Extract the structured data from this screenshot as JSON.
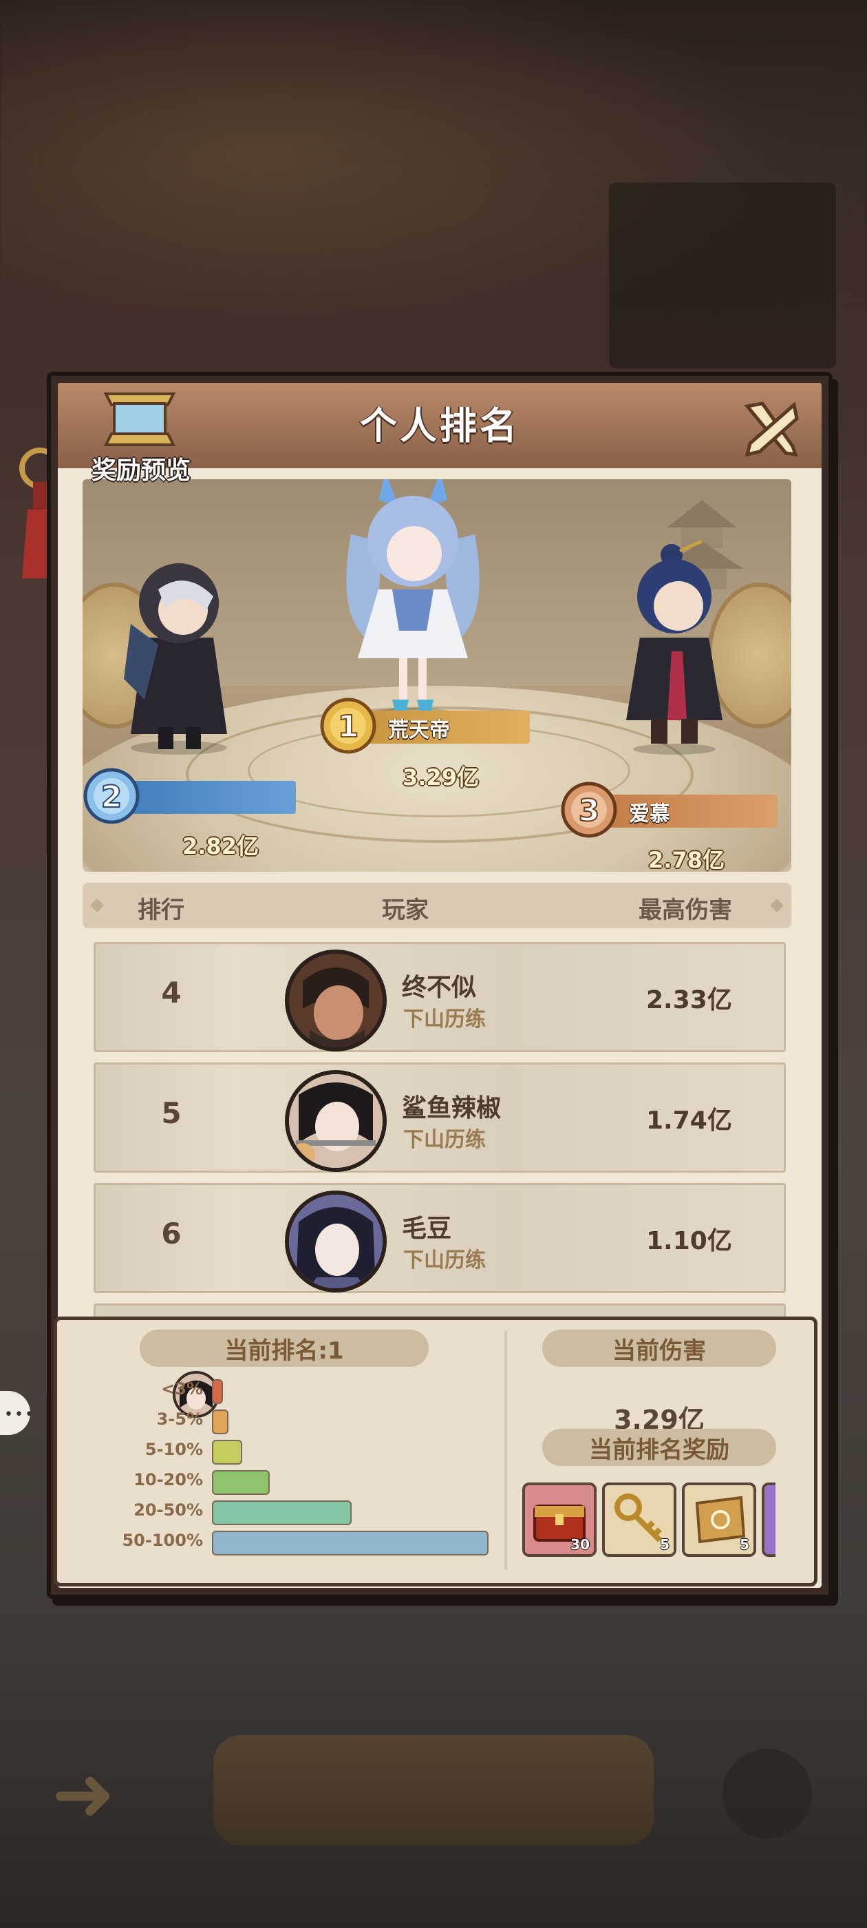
{
  "dialog": {
    "title": "个人排名",
    "reward_preview_label": "奖励预览"
  },
  "podium": [
    {
      "rank": "1",
      "name": "荒天帝",
      "damage": "3.29亿",
      "color": "#c8923c"
    },
    {
      "rank": "2",
      "name": "",
      "damage": "2.82亿",
      "color": "#3f7ab8"
    },
    {
      "rank": "3",
      "name": "爱慕",
      "damage": "2.78亿",
      "color": "#c07a44"
    }
  ],
  "list_header": {
    "rank": "排行",
    "player": "玩家",
    "damage": "最高伤害"
  },
  "rows": [
    {
      "rank": "4",
      "name": "终不似",
      "title": "下山历练",
      "damage": "2.33亿"
    },
    {
      "rank": "5",
      "name": "鲨鱼辣椒",
      "title": "下山历练",
      "damage": "1.74亿"
    },
    {
      "rank": "6",
      "name": "毛豆",
      "title": "下山历练",
      "damage": "1.10亿"
    }
  ],
  "current": {
    "rank_label": "当前排名:1",
    "damage_label": "当前伤害",
    "damage_value": "3.29亿",
    "reward_label": "当前排名奖励"
  },
  "distribution": [
    {
      "label": "<3%",
      "fill": 0.03,
      "color": "#d9674a"
    },
    {
      "label": "3-5%",
      "fill": 0.05,
      "color": "#e0a35a"
    },
    {
      "label": "5-10%",
      "fill": 0.1,
      "color": "#c4cc60"
    },
    {
      "label": "10-20%",
      "fill": 0.2,
      "color": "#8ec46c"
    },
    {
      "label": "20-50%",
      "fill": 0.5,
      "color": "#86c4a6"
    },
    {
      "label": "50-100%",
      "fill": 1.0,
      "color": "#8fb6cc"
    }
  ],
  "rewards": [
    {
      "icon": "treasure-chest-icon",
      "count": "30",
      "bg": "#d98a8a"
    },
    {
      "icon": "golden-key-icon",
      "count": "5",
      "bg": "#e8d6b0"
    },
    {
      "icon": "scroll-ticket-icon",
      "count": "5",
      "bg": "#e8d6b0"
    },
    {
      "icon": "purple-item-icon",
      "count": "",
      "bg": "#9a70c8"
    }
  ]
}
